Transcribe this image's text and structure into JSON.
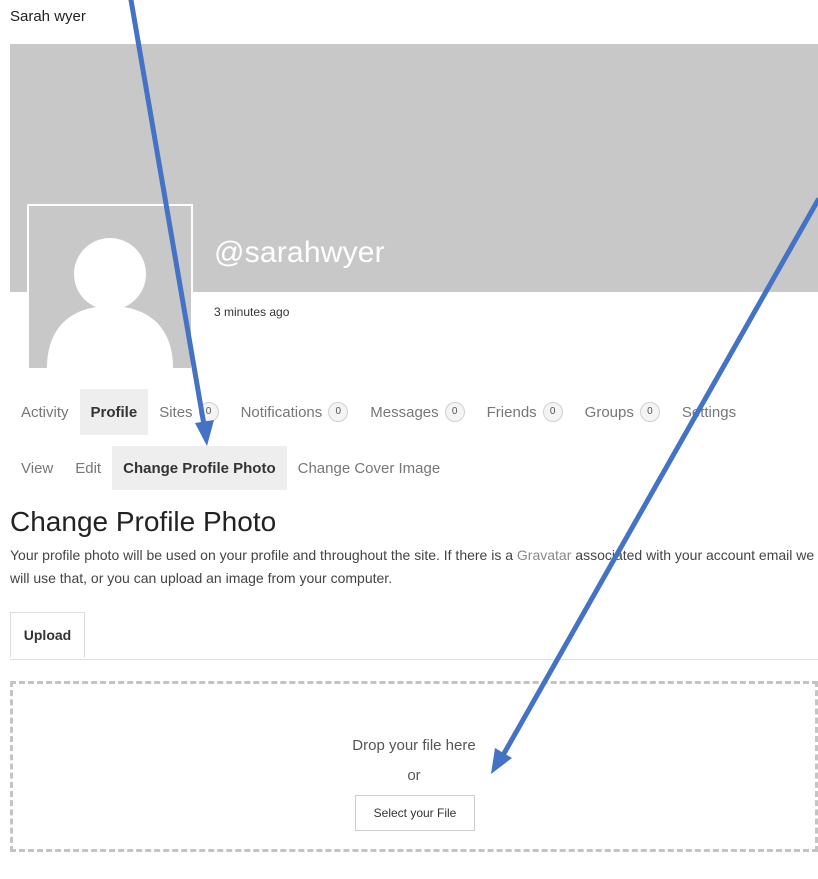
{
  "header": {
    "site_name": "Sarah wyer"
  },
  "profile": {
    "handle": "@sarahwyer",
    "last_active": "3 minutes ago",
    "cover_color": "#c8c8c8"
  },
  "primary_nav": {
    "activity": "Activity",
    "profile": "Profile",
    "sites": "Sites",
    "sites_count": "0",
    "notifications": "Notifications",
    "notifications_count": "0",
    "messages": "Messages",
    "messages_count": "0",
    "friends": "Friends",
    "friends_count": "0",
    "groups": "Groups",
    "groups_count": "0",
    "settings": "Settings"
  },
  "sub_nav": {
    "view": "View",
    "edit": "Edit",
    "change_profile_photo": "Change Profile Photo",
    "change_cover_image": "Change Cover Image"
  },
  "main": {
    "title": "Change Profile Photo",
    "intro_before_link": "Your profile photo will be used on your profile and throughout the site. If there is a ",
    "intro_link": "Gravatar",
    "intro_after_link": " associated with your account email we will use that, or you can upload an image from your computer.",
    "tab_upload": "Upload",
    "drop_text": "Drop your file here",
    "or_text": "or",
    "select_button": "Select your File"
  },
  "annotation": {
    "arrow_color": "#4472c4"
  }
}
